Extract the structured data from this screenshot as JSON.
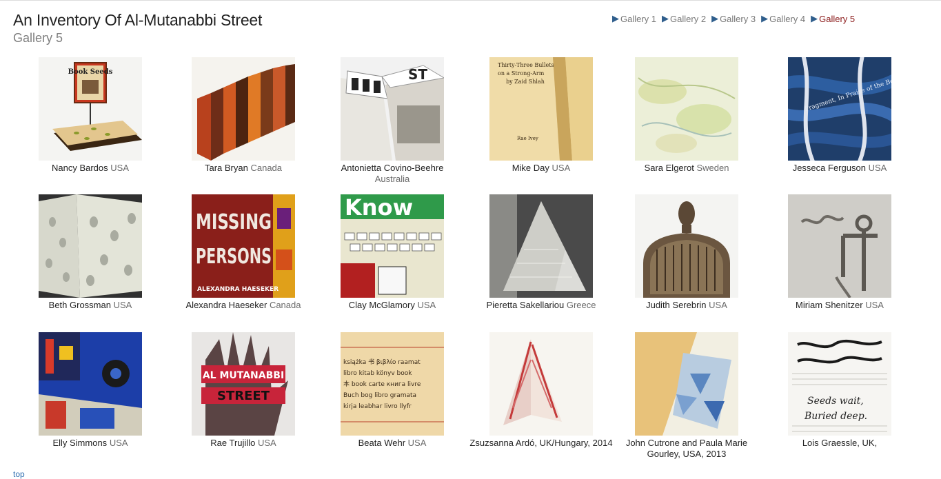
{
  "header": {
    "title": "An Inventory Of Al-Mutanabbi Street",
    "subtitle": "Gallery 5"
  },
  "nav": [
    {
      "label": "Gallery 1",
      "current": false
    },
    {
      "label": "Gallery 2",
      "current": false
    },
    {
      "label": "Gallery 3",
      "current": false
    },
    {
      "label": "Gallery 4",
      "current": false
    },
    {
      "label": "Gallery 5",
      "current": true
    }
  ],
  "nav_arrow_icon": "triangle-right",
  "colors": {
    "nav_arrow": "#2f5e8c",
    "nav_current": "#8b1a1a",
    "link": "#2f6fb0"
  },
  "items": [
    {
      "name": "Nancy Bardos",
      "country": "USA",
      "img": {
        "t": "Book Seeds"
      }
    },
    {
      "name": "Tara Bryan",
      "country": "Canada"
    },
    {
      "name": "Antonietta Covino-Beehre",
      "country": "Australia"
    },
    {
      "name": "Mike Day",
      "country": "USA",
      "img": {
        "t": "Thirty-Three Bullets on a Strong-Arm"
      }
    },
    {
      "name": "Sara Elgerot",
      "country": "Sweden"
    },
    {
      "name": "Jesseca Ferguson",
      "country": "USA",
      "img": {
        "t": "Fragment, In Praise of the Book"
      }
    },
    {
      "name": "Beth Grossman",
      "country": "USA"
    },
    {
      "name": "Alexandra Haeseker",
      "country": "Canada",
      "img": {
        "t1": "MISSING",
        "t2": "PERSONS",
        "t3": "ALEXANDRA HAESEKER"
      }
    },
    {
      "name": "Clay McGlamory",
      "country": "USA",
      "img": {
        "t": "Know"
      }
    },
    {
      "name": "Pieretta Sakellariou",
      "country": "Greece"
    },
    {
      "name": "Judith Serebrin",
      "country": "USA"
    },
    {
      "name": "Miriam Shenitzer",
      "country": "USA"
    },
    {
      "name": "Elly Simmons",
      "country": "USA"
    },
    {
      "name": "Rae Trujillo",
      "country": "USA",
      "img": {
        "t1": "AL MUTANABBI",
        "t2": "STREET"
      }
    },
    {
      "name": "Beata Wehr",
      "country": "USA",
      "img": {
        "lines": [
          "książka 书 βιβλίο raamat",
          "libro kitab könyv book",
          "本 book carte книга livre",
          "Buch bog libro gramata",
          "kirja leabhar livro llyfr"
        ]
      }
    },
    {
      "name": "Zsuzsanna Ardó, UK/Hungary, 2014",
      "country": ""
    },
    {
      "name": "John Cutrone and Paula Marie Gourley, USA, 2013",
      "country": ""
    },
    {
      "name": "Lois Graessle, UK,",
      "country": "",
      "img": {
        "t1": "Seeds wait,",
        "t2": "Buried deep."
      }
    }
  ],
  "footer": {
    "top_link": "top"
  }
}
